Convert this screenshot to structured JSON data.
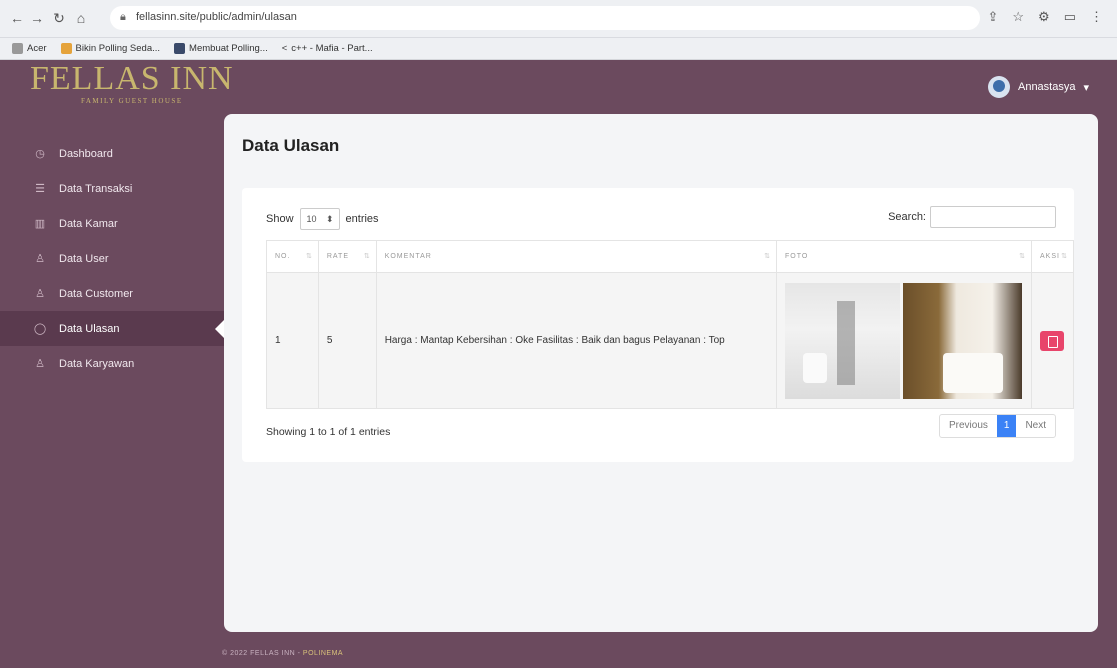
{
  "browser": {
    "url": "fellasinn.site/public/admin/ulasan",
    "bookmarks": [
      "Acer",
      "Bikin Polling Seda...",
      "Membuat Polling...",
      "c++ - Mafia - Part..."
    ]
  },
  "brand": {
    "name": "FELLAS INN",
    "tagline": "FAMILY GUEST HOUSE",
    "color": "#c8b66e"
  },
  "user": {
    "name": "Annastasya"
  },
  "sidebar": {
    "items": [
      {
        "label": "Dashboard",
        "icon": "clock-icon"
      },
      {
        "label": "Data Transaksi",
        "icon": "list-icon"
      },
      {
        "label": "Data Kamar",
        "icon": "columns-icon"
      },
      {
        "label": "Data User",
        "icon": "user-icon"
      },
      {
        "label": "Data Customer",
        "icon": "user-plus-icon"
      },
      {
        "label": "Data Ulasan",
        "icon": "comment-icon",
        "active": true
      },
      {
        "label": "Data Karyawan",
        "icon": "users-icon"
      }
    ]
  },
  "page": {
    "title": "Data Ulasan"
  },
  "table": {
    "show_label": "Show",
    "entries_value": "10",
    "entries_label": "entries",
    "search_label": "Search:",
    "headers": [
      "NO.",
      "RATE",
      "KOMENTAR",
      "FOTO",
      "AKSI"
    ],
    "rows": [
      {
        "no": "1",
        "rate": "5",
        "komentar": "Harga : Mantap Kebersihan : Oke Fasilitas : Baik dan bagus Pelayanan : Top"
      }
    ],
    "info": "Showing 1 to 1 of 1 entries",
    "pagination": {
      "previous": "Previous",
      "current": "1",
      "next": "Next"
    }
  },
  "footer": {
    "copyright": "© 2022 FELLAS INN -",
    "org": "POLINEMA"
  },
  "colors": {
    "sidebar_bg": "#6b4a5e",
    "active_bg": "#5a3a4e",
    "delete": "#e8456b",
    "page_active": "#3b82f6"
  }
}
